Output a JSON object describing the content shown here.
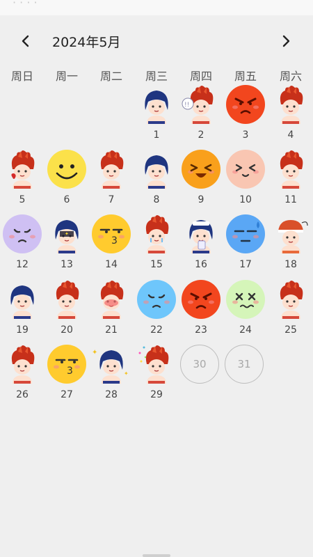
{
  "header": {
    "title": "2024年5月",
    "prev_icon": "chevron-left-icon",
    "next_icon": "chevron-right-icon"
  },
  "weekdays": [
    "周日",
    "周一",
    "周二",
    "周三",
    "周四",
    "周五",
    "周六"
  ],
  "days": [
    {
      "day": "1",
      "mood": "blue-hair-girl-shy"
    },
    {
      "day": "2",
      "mood": "red-hair-boy-speech"
    },
    {
      "day": "3",
      "mood": "angry-red-face"
    },
    {
      "day": "4",
      "mood": "red-hair-boy-wave"
    },
    {
      "day": "5",
      "mood": "red-hair-boy-heart"
    },
    {
      "day": "6",
      "mood": "smile-yellow-face"
    },
    {
      "day": "7",
      "mood": "red-hair-boy-shy"
    },
    {
      "day": "8",
      "mood": "blue-hair-girl-worried"
    },
    {
      "day": "9",
      "mood": "laugh-orange-face"
    },
    {
      "day": "10",
      "mood": "happy-pink-face"
    },
    {
      "day": "11",
      "mood": "red-hair-boy-cry"
    },
    {
      "day": "12",
      "mood": "sad-purple-face"
    },
    {
      "day": "13",
      "mood": "blue-hair-girl-dark"
    },
    {
      "day": "14",
      "mood": "kiss-yellow-face"
    },
    {
      "day": "15",
      "mood": "red-hair-boy-tears"
    },
    {
      "day": "16",
      "mood": "blue-hair-girl-sick"
    },
    {
      "day": "17",
      "mood": "sweat-blue-face"
    },
    {
      "day": "18",
      "mood": "orange-hair-boy-hat"
    },
    {
      "day": "19",
      "mood": "blue-hair-girl-arms"
    },
    {
      "day": "20",
      "mood": "red-hair-boy-grumpy"
    },
    {
      "day": "21",
      "mood": "red-hair-boy-blush"
    },
    {
      "day": "22",
      "mood": "sad-blue-face"
    },
    {
      "day": "23",
      "mood": "angry-red-face"
    },
    {
      "day": "24",
      "mood": "dizzy-green-face"
    },
    {
      "day": "25",
      "mood": "red-hair-boy-angry"
    },
    {
      "day": "26",
      "mood": "red-hair-boy-sulk"
    },
    {
      "day": "27",
      "mood": "kiss-yellow-face"
    },
    {
      "day": "28",
      "mood": "blue-hair-girl-sparkle"
    },
    {
      "day": "29",
      "mood": "red-hair-boy-party"
    },
    {
      "day": "30",
      "mood": "none"
    },
    {
      "day": "31",
      "mood": "none"
    }
  ],
  "colors": {
    "angry_red": "#f2461e",
    "smile_yellow": "#fbe14a",
    "laugh_orange": "#f9a01b",
    "happy_pink": "#f9c6b2",
    "sad_purple": "#cfc0f3",
    "kiss_yellow": "#ffcb2e",
    "sweat_blue": "#5aa7f5",
    "sad_blue": "#6ec6fb",
    "dizzy_green": "#d5f5b9",
    "red_hair": "#c7301a",
    "blue_hair": "#1f3580"
  }
}
